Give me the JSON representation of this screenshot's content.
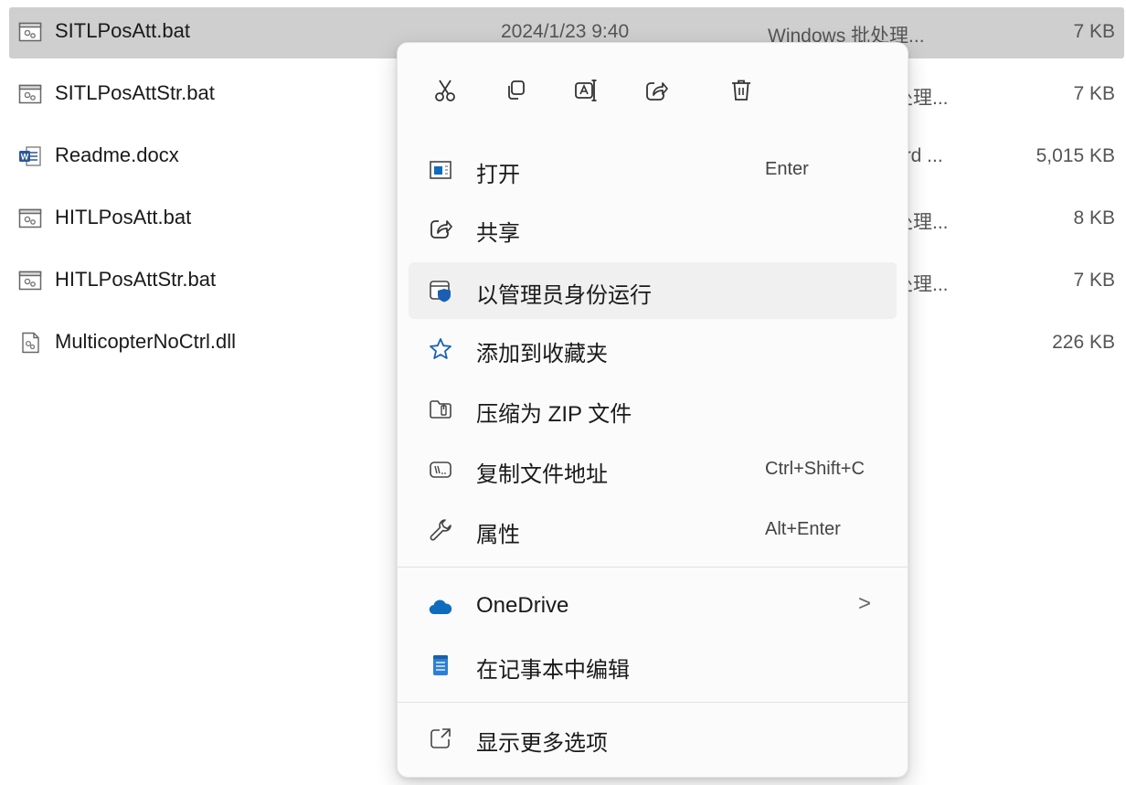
{
  "files": [
    {
      "name": "SITLPosAtt.bat",
      "date": "2024/1/23 9:40",
      "type": "Windows 批处理...",
      "size": "7 KB",
      "icon": "batch-file-icon",
      "selected": true
    },
    {
      "name": "SITLPosAttStr.bat",
      "type_tail": "处理...",
      "size": "7 KB",
      "icon": "batch-file-icon"
    },
    {
      "name": "Readme.docx",
      "type_tail": "ord ...",
      "size": "5,015 KB",
      "icon": "word-document-icon"
    },
    {
      "name": "HITLPosAtt.bat",
      "type_tail": "处理...",
      "size": "8 KB",
      "icon": "batch-file-icon"
    },
    {
      "name": "HITLPosAttStr.bat",
      "type_tail": "处理...",
      "size": "7 KB",
      "icon": "batch-file-icon"
    },
    {
      "name": "MulticopterNoCtrl.dll",
      "size": "226 KB",
      "icon": "dll-file-icon"
    }
  ],
  "context_menu": {
    "toolbar": [
      {
        "name": "cut",
        "icon": "scissors-icon"
      },
      {
        "name": "copy",
        "icon": "copy-icon"
      },
      {
        "name": "rename",
        "icon": "rename-icon"
      },
      {
        "name": "share",
        "icon": "share-icon"
      },
      {
        "name": "delete",
        "icon": "trash-icon"
      }
    ],
    "items": [
      {
        "label": "打开",
        "shortcut": "Enter",
        "icon": "open-window-icon"
      },
      {
        "label": "共享",
        "icon": "share-icon"
      },
      {
        "label": "以管理员身份运行",
        "icon": "admin-shield-icon",
        "hover": true
      },
      {
        "label": "添加到收藏夹",
        "icon": "star-icon"
      },
      {
        "label": "压缩为 ZIP 文件",
        "icon": "zip-folder-icon"
      },
      {
        "label": "复制文件地址",
        "shortcut": "Ctrl+Shift+C",
        "icon": "copy-path-icon"
      },
      {
        "label": "属性",
        "shortcut": "Alt+Enter",
        "icon": "wrench-icon"
      },
      {
        "label": "OneDrive",
        "icon": "cloud-icon",
        "submenu": ">"
      },
      {
        "label": "在记事本中编辑",
        "icon": "notepad-icon"
      },
      {
        "label": "显示更多选项",
        "icon": "more-options-icon"
      }
    ]
  },
  "colors": {
    "selection": "#cfcfcf",
    "onedrive_blue": "#0f6cbd",
    "shield_blue": "#1a5fb4"
  }
}
